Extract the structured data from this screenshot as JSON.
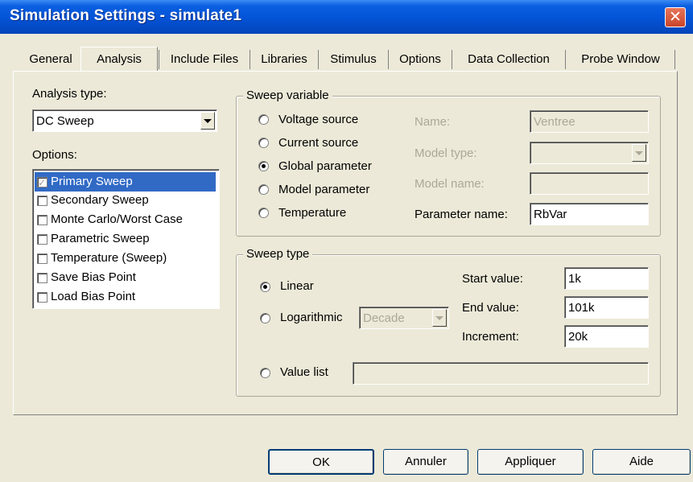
{
  "window": {
    "title": "Simulation Settings - simulate1",
    "close_glyph": "✕"
  },
  "tabs": [
    {
      "label": "General"
    },
    {
      "label": "Analysis"
    },
    {
      "label": "Include Files"
    },
    {
      "label": "Libraries"
    },
    {
      "label": "Stimulus"
    },
    {
      "label": "Options"
    },
    {
      "label": "Data Collection"
    },
    {
      "label": "Probe Window"
    }
  ],
  "active_tab": "Analysis",
  "analysis_type": {
    "label": "Analysis type:",
    "value": "DC Sweep"
  },
  "options": {
    "label": "Options:",
    "items": [
      {
        "label": "Primary Sweep",
        "checked": true,
        "selected": true
      },
      {
        "label": "Secondary Sweep",
        "checked": false
      },
      {
        "label": "Monte Carlo/Worst Case",
        "checked": false
      },
      {
        "label": "Parametric Sweep",
        "checked": false
      },
      {
        "label": "Temperature (Sweep)",
        "checked": false
      },
      {
        "label": "Save Bias Point",
        "checked": false
      },
      {
        "label": "Load Bias Point",
        "checked": false
      }
    ]
  },
  "sweep_variable": {
    "title": "Sweep variable",
    "options": [
      {
        "label": "Voltage source",
        "checked": false
      },
      {
        "label": "Current source",
        "checked": false
      },
      {
        "label": "Global parameter",
        "checked": true
      },
      {
        "label": "Model parameter",
        "checked": false
      },
      {
        "label": "Temperature",
        "checked": false
      }
    ],
    "name_label": "Name:",
    "name_value": "Ventree",
    "model_type_label": "Model type:",
    "model_type_value": "",
    "model_name_label": "Model name:",
    "model_name_value": "",
    "parameter_name_label": "Parameter name:",
    "parameter_name_value": "RbVar"
  },
  "sweep_type": {
    "title": "Sweep type",
    "linear_label": "Linear",
    "logarithmic_label": "Logarithmic",
    "log_scale_value": "Decade",
    "value_list_label": "Value list",
    "value_list_value": "",
    "selected": "Linear",
    "start_label": "Start value:",
    "start_value": "1k",
    "end_label": "End value:",
    "end_value": "101k",
    "increment_label": "Increment:",
    "increment_value": "20k"
  },
  "buttons": {
    "ok": "OK",
    "cancel": "Annuler",
    "apply": "Appliquer",
    "help": "Aide"
  },
  "colors": {
    "title_bar": "#0453d6",
    "selection": "#316ac5",
    "dialog_bg": "#ece9d8",
    "close_button": "#c9452a"
  }
}
